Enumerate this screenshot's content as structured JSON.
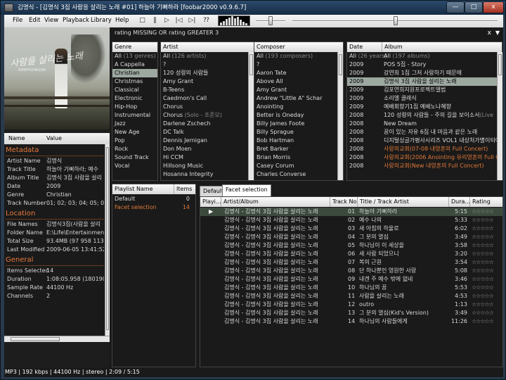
{
  "window": {
    "title": "김명식 - [김명식 3집 사람을 살리는 노래 #01] 하늘아 기뻐하라   [foobar2000 v0.9.6.7]",
    "min_label": "—",
    "max_label": "□",
    "close_label": "x"
  },
  "menu": {
    "items": [
      "File",
      "Edit",
      "View",
      "Playback",
      "Library",
      "Help"
    ],
    "toolbar_icons": [
      "stop-icon",
      "pause-icon",
      "play-icon",
      "previous-icon",
      "next-icon",
      "random-icon"
    ],
    "toolbar_glyphs": [
      "□",
      "‖",
      "▷",
      "|◁",
      "▷|",
      "⁇"
    ],
    "volume": 0.4,
    "seek": 0.48
  },
  "filter": {
    "query": "rating MISSING OR rating GREATER 3",
    "dropdown_glyph": "▼",
    "close_glyph": "x"
  },
  "properties": {
    "header": {
      "name": "Name",
      "value": "Value"
    },
    "sections": [
      {
        "title": "Metadata",
        "rows": [
          {
            "k": "Artist Name",
            "v": "김명식"
          },
          {
            "k": "Track Title",
            "v": "하늘아 기뻐하라; 예수"
          },
          {
            "k": "Album Title",
            "v": "김명식 3집 사람을 살리"
          },
          {
            "k": "Date",
            "v": "2009"
          },
          {
            "k": "Genre",
            "v": "Christian"
          },
          {
            "k": "Track Number",
            "v": "01; 02; 03; 04; 05; 06"
          }
        ]
      },
      {
        "title": "Location",
        "rows": [
          {
            "k": "File Names",
            "v": "김명식3집(사람을 살리"
          },
          {
            "k": "Folder Name",
            "v": "E:\\Life\\Entertainment\\"
          },
          {
            "k": "Total Size",
            "v": "93.4MB (97 958 113 b"
          },
          {
            "k": "Last Modified",
            "v": "2009-06-05 13:41:52"
          }
        ]
      },
      {
        "title": "General",
        "rows": [
          {
            "k": "Items Selected",
            "v": "14"
          },
          {
            "k": "Duration",
            "v": "1:08:05.958 (1801907"
          },
          {
            "k": "Sample Rate",
            "v": "44100 Hz"
          },
          {
            "k": "Channels",
            "v": "2"
          }
        ]
      }
    ]
  },
  "facets": {
    "genre": {
      "header": "Genre",
      "all": "All",
      "all_count": "(13 genres)",
      "items": [
        "A Cappella",
        "Christian",
        "Christmas",
        "Classical",
        "Electronic",
        "Hip-Hop",
        "Instrumental",
        "Jazz",
        "New Age",
        "Pop",
        "Rock",
        "Sound Track",
        "Vocal"
      ],
      "selected": "Christian"
    },
    "artist": {
      "header": "Artist",
      "all": "All",
      "all_count": "(126 artists)",
      "items": [
        {
          "name": "?",
          "extra": ""
        },
        {
          "name": "120 성령의 사람들",
          "extra": ""
        },
        {
          "name": "Amy Grant",
          "extra": ""
        },
        {
          "name": "B-Teens",
          "extra": ""
        },
        {
          "name": "Caedmon's Call",
          "extra": ""
        },
        {
          "name": "Chorus",
          "extra": ""
        },
        {
          "name": "Chorus",
          "extra": "(Solo - 조준모)"
        },
        {
          "name": "Darlene Zschech",
          "extra": ""
        },
        {
          "name": "DC Talk",
          "extra": ""
        },
        {
          "name": "Dennis Jernigan",
          "extra": ""
        },
        {
          "name": "Don Moen",
          "extra": ""
        },
        {
          "name": "Hi CCM",
          "extra": ""
        },
        {
          "name": "Hillsong Music",
          "extra": ""
        },
        {
          "name": "Hosanna Integrity",
          "extra": ""
        }
      ]
    },
    "composer": {
      "header": "Composer",
      "all": "All",
      "all_count": "(193 composers)",
      "items": [
        "?",
        "Aaron Tate",
        "Above All",
        "Amy Grant",
        "Andrew \"Little A\" Schar",
        "Anointing",
        "Better is Oneday",
        "Billy James Foote",
        "Billy Sprague",
        "Bob Hartman",
        "Bret Barker",
        "Brian Morris",
        "Casey Corum",
        "Charles Converse"
      ]
    },
    "date_album": {
      "header_date": "Date",
      "header_album": "Album",
      "all": "All",
      "all_count": "(26 years)",
      "all_album": "All",
      "all_album_count": "(197 albums)",
      "rows": [
        {
          "date": "2009",
          "album": "POS 5집 - Story",
          "extra": "",
          "orange": false
        },
        {
          "date": "2009",
          "album": "강연희 1집 그저 사랑하기 때문에",
          "extra": "",
          "orange": false
        },
        {
          "date": "2009",
          "album": "김명식 3집 사람을 살리는 노래",
          "extra": "",
          "orange": false
        },
        {
          "date": "2009",
          "album": "김포연희지원프로젝트앨범",
          "extra": "",
          "orange": false
        },
        {
          "date": "2009",
          "album": "소리엘 클래식",
          "extra": "",
          "orange": false
        },
        {
          "date": "2009",
          "album": "예배회향기1집 예배노나혜향",
          "extra": "",
          "orange": false
        },
        {
          "date": "2008",
          "album": "120 성령의 사람들 - 주의 길을 보이소서",
          "extra": "(Live",
          "orange": false
        },
        {
          "date": "2008",
          "album": "New Dream",
          "extra": "",
          "orange": false
        },
        {
          "date": "2008",
          "album": "꿈이 있는 자유 6집 내 마음과 같은 노래",
          "extra": "",
          "orange": false
        },
        {
          "date": "2008",
          "album": "디지털싱글가평사시리즈 VOL1 내상처가별이되어",
          "extra": "",
          "orange": false
        },
        {
          "date": "2008",
          "album": "사랑의교회",
          "extra": "(07-08 내영혼의 Full Concert)",
          "orange": true
        },
        {
          "date": "2008",
          "album": "사랑의교회",
          "extra": "(2006 Anointing 유리영혼의 Full Co",
          "orange": true
        },
        {
          "date": "2008",
          "album": "사랑의교회",
          "extra": "(New 내영혼의 Full Concert)",
          "orange": true
        }
      ],
      "selected_index": 2
    }
  },
  "playlists": {
    "header_name": "Playlist Name",
    "header_items": "Items",
    "items": [
      {
        "name": "Default",
        "count": "0",
        "active": false
      },
      {
        "name": "Facet selection",
        "count": "14",
        "active": true
      }
    ]
  },
  "tabs": [
    "Default",
    "Facet selection"
  ],
  "active_tab": "Facet selection",
  "playlist_view": {
    "columns": [
      "Playi...",
      "Artist/Album",
      "Track No",
      "Title / Track Artist",
      "Dura...",
      "Rating"
    ],
    "playing_glyph": "▶",
    "rating_glyph": "☆☆☆☆☆",
    "tracks": [
      {
        "artist_album": "김명식 - 김명식 3집 사람을 살리는 노래",
        "no": "01",
        "title": "하늘아 기뻐하라",
        "duration": "5:15"
      },
      {
        "artist_album": "김명식 - 김명식 3집 사람을 살리는 노래",
        "no": "02",
        "title": "예수 나의",
        "duration": "5:33"
      },
      {
        "artist_album": "김명식 - 김명식 3집 사람을 살리는 노래",
        "no": "03",
        "title": "새 아침의 하울로",
        "duration": "6:02"
      },
      {
        "artist_album": "김명식 - 김명식 3집 사람을 살리는 노래",
        "no": "04",
        "title": "그 분의 열심",
        "duration": "3:49"
      },
      {
        "artist_album": "김명식 - 김명식 3집 사람을 살리는 노래",
        "no": "05",
        "title": "하나님이 이 세상을",
        "duration": "3:58"
      },
      {
        "artist_album": "김명식 - 김명식 3집 사람을 살리는 노래",
        "no": "06",
        "title": "새 사람 되었으니",
        "duration": "3:20"
      },
      {
        "artist_album": "김명식 - 김명식 3집 사람을 살리는 노래",
        "no": "07",
        "title": "복의 근원",
        "duration": "3:54"
      },
      {
        "artist_album": "김명식 - 김명식 3집 사람을 살리는 노래",
        "no": "08",
        "title": "단 하나뿐인 영원한 사랑",
        "duration": "5:08"
      },
      {
        "artist_album": "김명식 - 김명식 3집 사람을 살리는 노래",
        "no": "09",
        "title": "내겐 주 예수 밖에 없네",
        "duration": "3:46"
      },
      {
        "artist_album": "김명식 - 김명식 3집 사람을 살리는 노래",
        "no": "10",
        "title": "하나님의 꿈",
        "duration": "5:53"
      },
      {
        "artist_album": "김명식 - 김명식 3집 사람을 살리는 노래",
        "no": "11",
        "title": "사람을 살리는 노래",
        "duration": "4:53"
      },
      {
        "artist_album": "김명식 - 김명식 3집 사람을 살리는 노래",
        "no": "12",
        "title": "outro",
        "duration": "1:13"
      },
      {
        "artist_album": "김명식 - 김명식 3집 사람을 살리는 노래",
        "no": "13",
        "title": "그 분의 열심(Kid's Version)",
        "duration": "3:49"
      },
      {
        "artist_album": "김명식 - 김명식 3집 사람을 살리는 노래",
        "no": "14",
        "title": "하나님의 사람들에게",
        "duration": "11:26"
      }
    ]
  },
  "album_art": {
    "script_text": "사람을 살리는 노래",
    "small_text": "KIMMYOUNGSIK"
  },
  "status": "MP3 | 192 kbps | 44100 Hz | stereo | 2:09 / 5:15",
  "colors": {
    "accent_orange": "#e07838",
    "selection": "#9ca8a0",
    "title_bar": "#1f3a58"
  }
}
